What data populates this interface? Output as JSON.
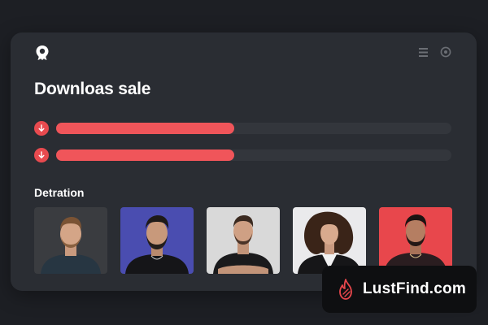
{
  "header": {
    "logo_icon": "location-pin-icon",
    "menu_icon": "menu-icon",
    "settings_icon": "gear-icon"
  },
  "main": {
    "title": "Downloas sale",
    "downloads": [
      {
        "icon": "download-arrow-icon",
        "progress": 0.45
      },
      {
        "icon": "download-arrow-icon",
        "progress": 0.45
      }
    ],
    "section_label": "Detration",
    "people": [
      {
        "bg": "#3a3c40"
      },
      {
        "bg": "#4a4db0"
      },
      {
        "bg": "#d9d9d9"
      },
      {
        "bg": "#eaeaec"
      },
      {
        "bg": "#e8474c"
      }
    ]
  },
  "watermark": {
    "icon": "flame-icon",
    "text": "LustFind.com"
  },
  "colors": {
    "accent": "#f0555a",
    "card": "#2a2d33",
    "background": "#1d1f24"
  }
}
